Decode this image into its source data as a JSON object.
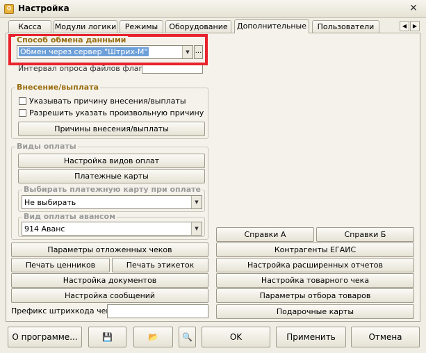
{
  "window": {
    "title": "Настройка",
    "close_glyph": "✕",
    "icon": "app-settings-icon"
  },
  "tabs": [
    {
      "label": "Касса"
    },
    {
      "label": "Модули логики"
    },
    {
      "label": "Режимы"
    },
    {
      "label": "Оборудование"
    },
    {
      "label": "Дополнительные",
      "active": true
    },
    {
      "label": "Пользователи"
    }
  ],
  "tab_scroll": {
    "left": "◀",
    "right": "▶"
  },
  "exchange": {
    "title": "Способ обмена данными",
    "value": "Обмен через сервер \"Штрих-М\"",
    "ellipsis": "...",
    "interval_label": "Интервал опроса файлов флагов:",
    "interval_value": ""
  },
  "deposit": {
    "title": "Внесение/выплата",
    "check_reason": "Указывать причину внесения/выплаты",
    "check_arbitrary": "Разрешить указать произвольную причину",
    "reasons_button": "Причины внесения/выплаты"
  },
  "payment_types": {
    "title": "Виды оплаты",
    "setup_button": "Настройка видов оплат",
    "cards_button": "Платежные карты",
    "choose_card_title": "Выбирать платежную карту при оплате",
    "choose_card_value": "Не выбирать",
    "advance_title": "Вид оплаты авансом",
    "advance_value": "914 Аванс"
  },
  "buttons": {
    "deferred": "Параметры отложенных чеков",
    "price_tags": "Печать ценников",
    "labels": "Печать этикеток",
    "documents": "Настройка документов",
    "messages": "Настройка сообщений",
    "spravki_a": "Справки А",
    "spravki_b": "Справки Б",
    "egais": "Контрагенты ЕГАИС",
    "extended_reports": "Настройка расширенных отчетов",
    "receipt": "Настройка товарного чека",
    "selection": "Параметры отбора товаров",
    "gift_cards": "Подарочные карты"
  },
  "prefix": {
    "label": "Префикс штрихкода чека:",
    "value": ""
  },
  "bottom": {
    "about": "О программе...",
    "save_icon": "💾",
    "export_icon": "📂",
    "search_icon": "🔍",
    "ok": "OK",
    "apply": "Применить",
    "cancel": "Отмена"
  }
}
